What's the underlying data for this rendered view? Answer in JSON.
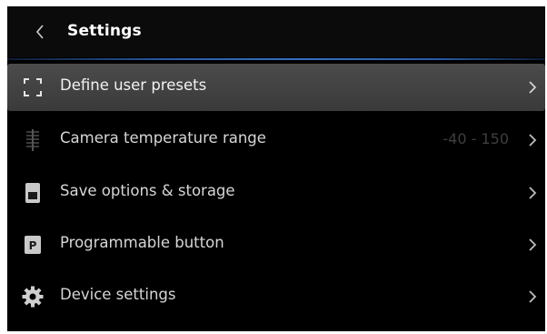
{
  "header": {
    "title": "Settings"
  },
  "menu": {
    "items": [
      {
        "label": "Define user presets",
        "value": "",
        "icon": "bracket-frame-icon",
        "selected": true
      },
      {
        "label": "Camera temperature range",
        "value": "-40 - 150",
        "icon": "thermometer-scale-icon",
        "selected": false
      },
      {
        "label": "Save options & storage",
        "value": "",
        "icon": "sd-card-icon",
        "selected": false
      },
      {
        "label": "Programmable button",
        "value": "",
        "icon": "programmable-p-icon",
        "selected": false
      },
      {
        "label": "Device settings",
        "value": "",
        "icon": "gear-icon",
        "selected": false
      }
    ]
  },
  "colors": {
    "background": "#000000",
    "selected_row": "#444444",
    "accent_line": "#3a70c4",
    "text": "#d6d6d6",
    "value_text": "#3f3f3f"
  }
}
